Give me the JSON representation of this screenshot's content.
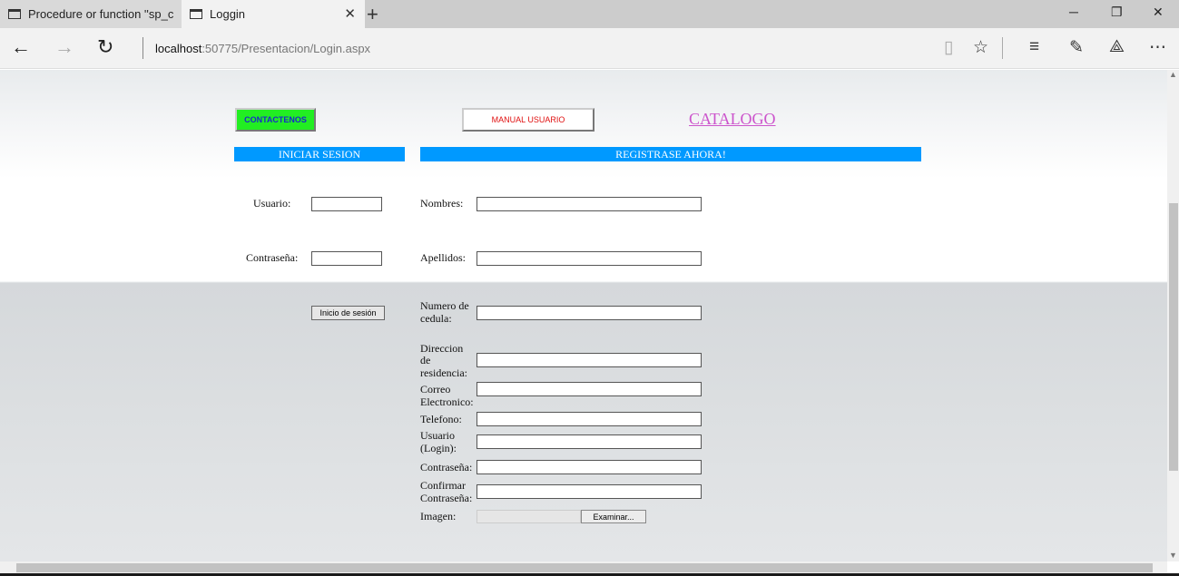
{
  "browser": {
    "tabs": [
      {
        "title": "Procedure or function ''sp_c",
        "active": false
      },
      {
        "title": "Loggin",
        "active": true
      }
    ],
    "address": {
      "host": "localhost",
      "rest": ":50775/Presentacion/Login.aspx"
    }
  },
  "page": {
    "buttons": {
      "contact": "CONTACTENOS",
      "manual": "MANUAL USUARIO",
      "login": "Inicio de sesión",
      "browse": "Examinar..."
    },
    "catalog_link": "CATALOGO",
    "headers": {
      "login": "INICIAR SESION",
      "register": "REGISTRASE AHORA!"
    },
    "login_form": {
      "usuario": "Usuario:",
      "password": "Contraseña:"
    },
    "register_form": {
      "nombres": "Nombres:",
      "apellidos": "Apellidos:",
      "cedula_1": "Numero de",
      "cedula_2": "cedula:",
      "direccion_1": "Direccion",
      "direccion_2": "de",
      "direccion_3": "residencia:",
      "correo_1": "Correo",
      "correo_2": "Electronico:",
      "telefono": "Telefono:",
      "usuario_1": "Usuario",
      "usuario_2": "(Login):",
      "password": "Contraseña:",
      "confirm_1": "Confirmar",
      "confirm_2": "Contraseña:",
      "imagen": "Imagen:"
    }
  },
  "colors": {
    "contact_bg": "#22ee22",
    "header_bg": "#0099ff",
    "catalog": "#cc55cc",
    "manual_text": "#e01010"
  }
}
